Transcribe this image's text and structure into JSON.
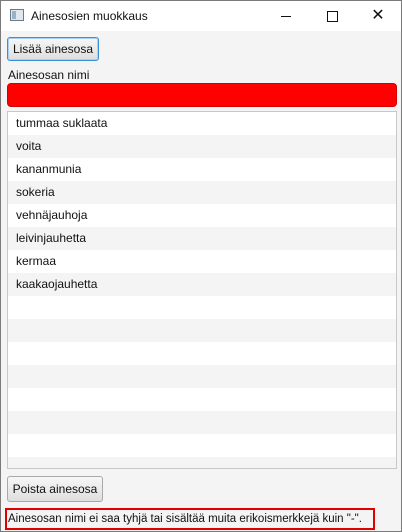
{
  "window": {
    "title": "Ainesosien muokkaus",
    "controls": {
      "minimize": "—",
      "maximize": "☐",
      "close": "✕"
    }
  },
  "toolbar": {
    "add_label": "Lisää ainesosa"
  },
  "form": {
    "name_label": "Ainesosan nimi",
    "name_value": "",
    "name_field_color": "#ff0000"
  },
  "ingredients": [
    "tummaa suklaata",
    "voita",
    "kananmunia",
    "sokeria",
    "vehnäjauhoja",
    "leivinjauhetta",
    "kermaa",
    "kaakaojauhetta"
  ],
  "actions": {
    "remove_label": "Poista ainesosa"
  },
  "status": {
    "error_message": "Ainesosan nimi ei saa tyhjä tai sisältää muita erikoismerkkejä kuin \"-\".",
    "error_color": "#e00000"
  }
}
